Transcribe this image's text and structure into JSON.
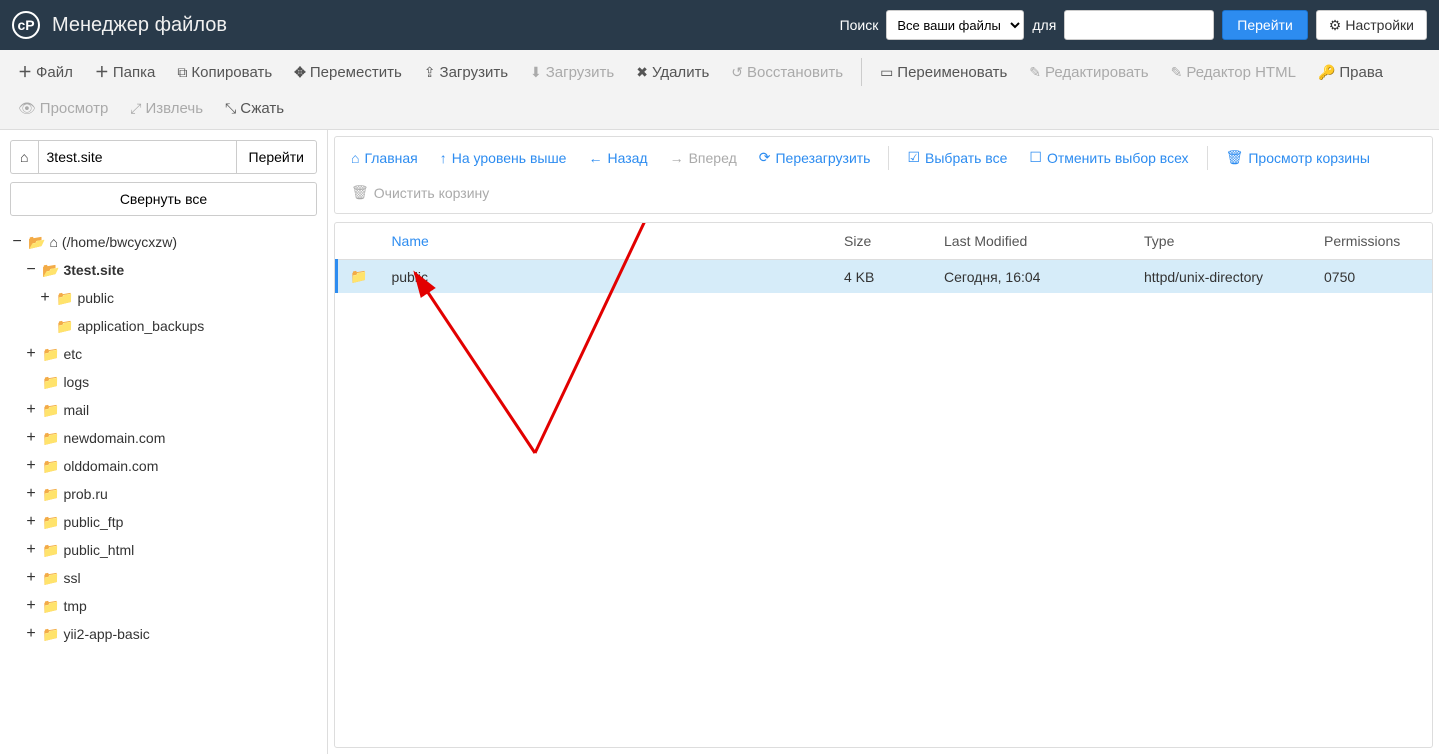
{
  "app": {
    "title": "Менеджер файлов"
  },
  "topbar": {
    "search_label": "Поиск",
    "for_label": "для",
    "go": "Перейти",
    "settings": "Настройки",
    "scope_select": {
      "options": [
        "Все ваши файлы"
      ],
      "selected": "Все ваши файлы"
    },
    "search_input_value": ""
  },
  "toolbar": {
    "file": "Файл",
    "folder": "Папка",
    "copy": "Копировать",
    "move": "Переместить",
    "upload": "Загрузить",
    "download": "Загрузить",
    "delete": "Удалить",
    "restore": "Восстановить",
    "rename": "Переименовать",
    "edit": "Редактировать",
    "html_editor": "Редактор HTML",
    "permissions": "Права",
    "view": "Просмотр",
    "extract": "Извлечь",
    "compress": "Сжать"
  },
  "sidebar": {
    "path_value": "3test.site",
    "go": "Перейти",
    "collapse_all": "Свернуть все",
    "tree": {
      "root_label": "(/home/bwcycxzw)",
      "children": [
        {
          "label": "3test.site",
          "open": true,
          "bold": true,
          "children": [
            {
              "label": "public",
              "expandable": true
            },
            {
              "label": "application_backups",
              "expandable": false
            }
          ]
        },
        {
          "label": "etc",
          "expandable": true
        },
        {
          "label": "logs",
          "expandable": false
        },
        {
          "label": "mail",
          "expandable": true
        },
        {
          "label": "newdomain.com",
          "expandable": true
        },
        {
          "label": "olddomain.com",
          "expandable": true
        },
        {
          "label": "prob.ru",
          "expandable": true
        },
        {
          "label": "public_ftp",
          "expandable": true
        },
        {
          "label": "public_html",
          "expandable": true
        },
        {
          "label": "ssl",
          "expandable": true
        },
        {
          "label": "tmp",
          "expandable": true
        },
        {
          "label": "yii2-app-basic",
          "expandable": true
        }
      ]
    }
  },
  "navstrip": {
    "home": "Главная",
    "up": "На уровень выше",
    "back": "Назад",
    "forward": "Вперед",
    "reload": "Перезагрузить",
    "select_all": "Выбрать все",
    "unselect_all": "Отменить выбор всех",
    "view_trash": "Просмотр корзины",
    "empty_trash": "Очистить корзину"
  },
  "table": {
    "cols": {
      "name": "Name",
      "size": "Size",
      "modified": "Last Modified",
      "type": "Type",
      "perms": "Permissions"
    },
    "rows": [
      {
        "name": "public",
        "size": "4 KB",
        "modified": "Сегодня, 16:04",
        "type": "httpd/unix-directory",
        "perms": "0750",
        "selected": true
      }
    ]
  }
}
